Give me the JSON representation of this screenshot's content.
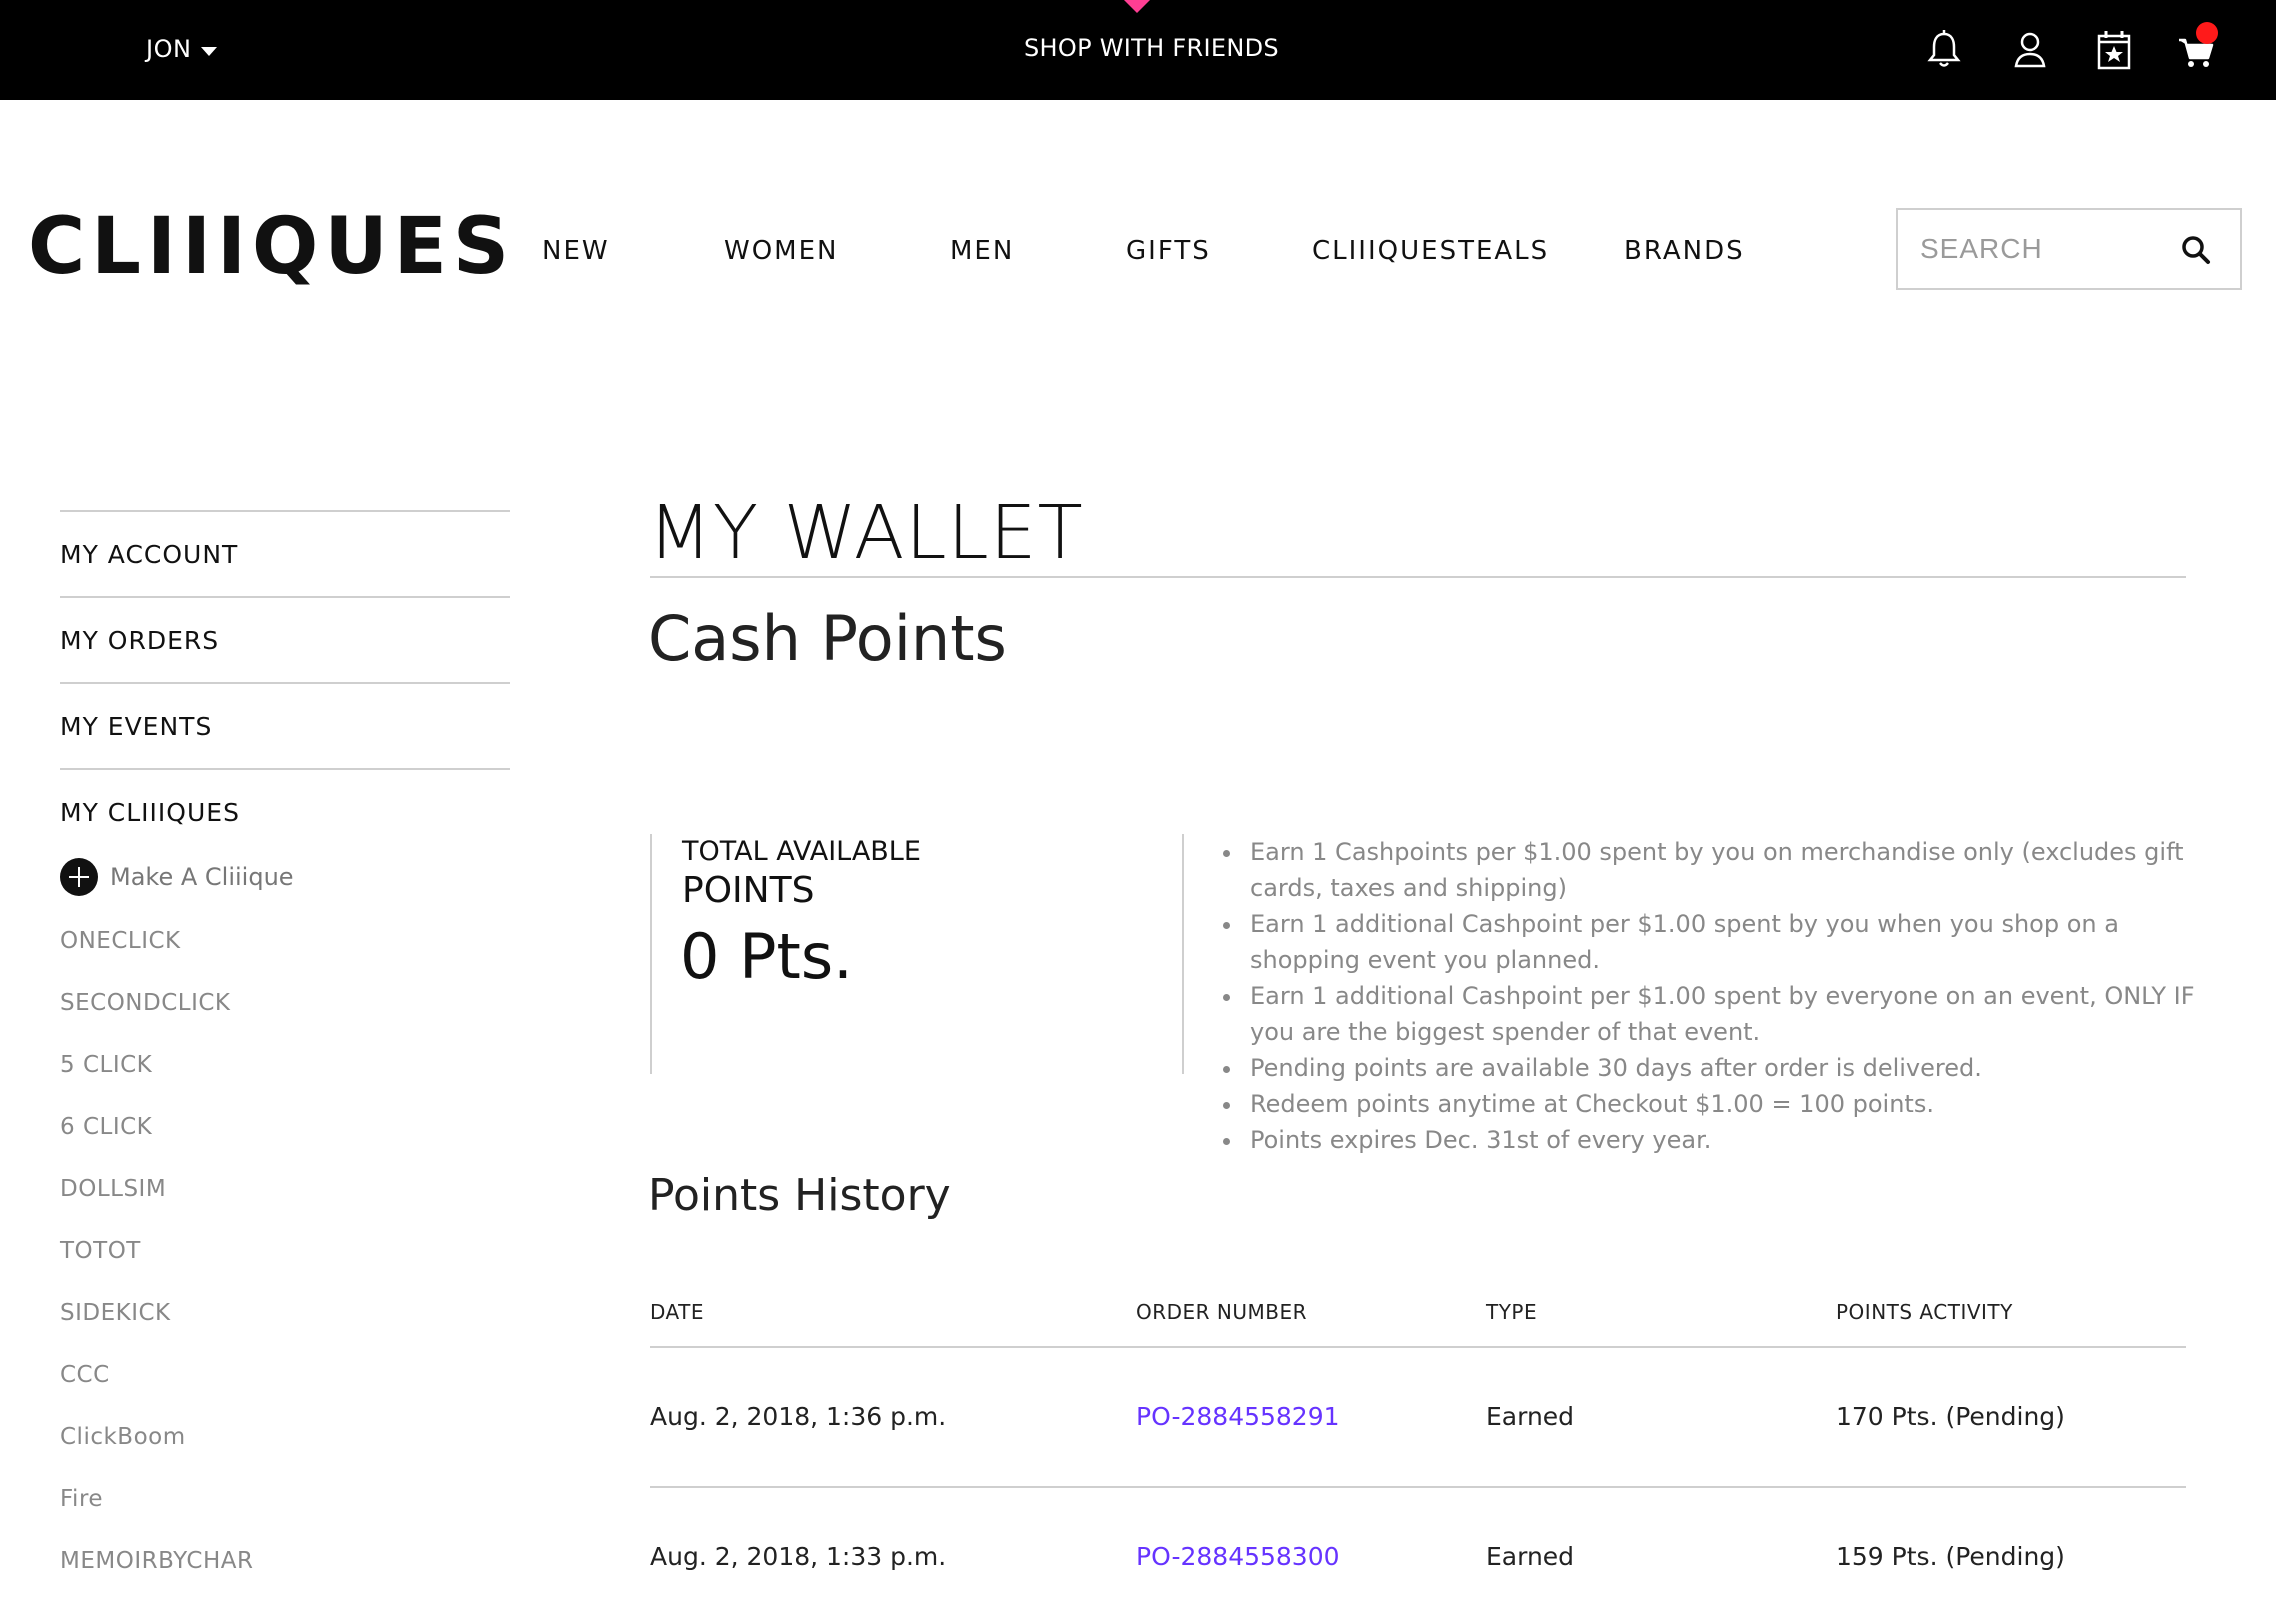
{
  "topbar": {
    "user": "JON",
    "center": "SHOP WITH FRIENDS",
    "icons": [
      "bell-icon",
      "user-icon",
      "calendar-star-icon",
      "cart-icon"
    ],
    "colors": {
      "marker": "#ff3e93",
      "badge": "#ff1a1a"
    }
  },
  "header": {
    "logo": "CLIIIQUES",
    "nav": [
      "NEW",
      "WOMEN",
      "MEN",
      "GIFTS",
      "CLIIIQUESTEALS",
      "BRANDS"
    ],
    "search_placeholder": "SEARCH"
  },
  "sidebar": {
    "main": [
      "MY ACCOUNT",
      "MY ORDERS",
      "MY EVENTS",
      "MY CLIIIQUES"
    ],
    "make": "Make A Cliiique",
    "sub": [
      "ONECLICK",
      "SECONDCLICK",
      "5 CLICK",
      "6 CLICK",
      "DOLLSIM",
      "TOTOT",
      "SIDEKICK",
      "CCC",
      "ClickBoom",
      "Fire",
      "MEMOIRBYCHAR"
    ]
  },
  "main": {
    "title": "MY WALLET",
    "subtitle": "Cash Points",
    "total_label1": "TOTAL AVAILABLE",
    "total_label2": "POINTS",
    "total_points": "0 Pts.",
    "rules": [
      "Earn 1 Cashpoints per $1.00 spent by you on merchandise only (excludes gift cards, taxes and shipping)",
      "Earn 1 additional Cashpoint per $1.00 spent by you when you shop on a shopping event you planned.",
      "Earn 1 additional Cashpoint per $1.00 spent by everyone on an event, ONLY IF you are the biggest spender of that event.",
      "Pending points are available 30 days after order is delivered.",
      "Redeem points anytime at Checkout $1.00 = 100 points.",
      "Points expires Dec. 31st of every year."
    ],
    "history_title": "Points History",
    "columns": [
      "DATE",
      "ORDER NUMBER",
      "TYPE",
      "POINTS ACTIVITY"
    ],
    "rows": [
      {
        "date": "Aug. 2, 2018, 1:36 p.m.",
        "order": "PO-2884558291",
        "type": "Earned",
        "points": "170 Pts. (Pending)"
      },
      {
        "date": "Aug. 2, 2018, 1:33 p.m.",
        "order": "PO-2884558300",
        "type": "Earned",
        "points": "159 Pts. (Pending)"
      }
    ],
    "link_color": "#6633ff"
  }
}
